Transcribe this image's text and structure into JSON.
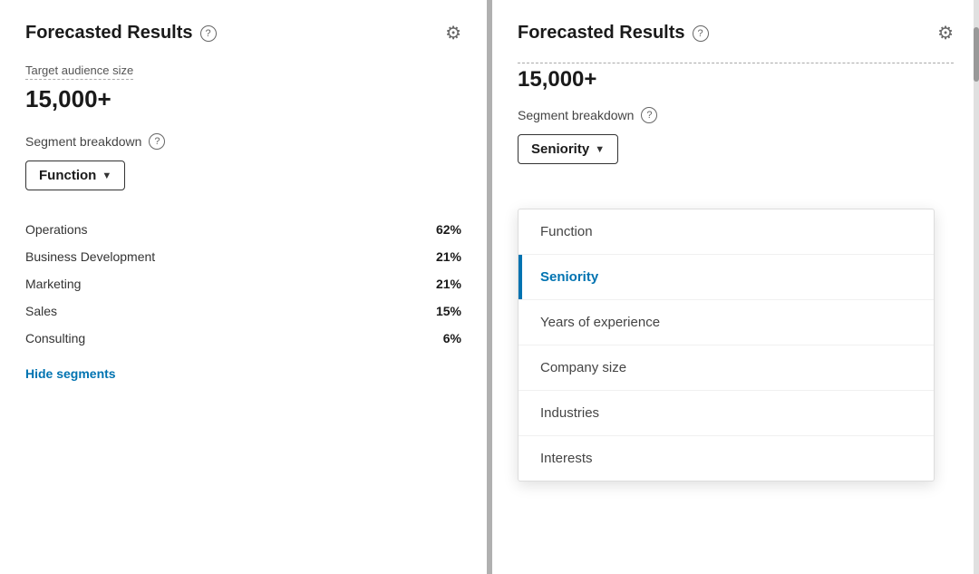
{
  "left_panel": {
    "title": "Forecasted Results",
    "help_icon": "?",
    "gear_icon": "⚙",
    "audience_label": "Target audience size",
    "audience_size": "15,000+",
    "segment_breakdown_label": "Segment breakdown",
    "dropdown_label": "Function",
    "segments": [
      {
        "name": "Operations",
        "pct": "62%"
      },
      {
        "name": "Business Development",
        "pct": "21%"
      },
      {
        "name": "Marketing",
        "pct": "21%"
      },
      {
        "name": "Sales",
        "pct": "15%"
      },
      {
        "name": "Consulting",
        "pct": "6%"
      }
    ],
    "hide_link": "Hide segments"
  },
  "right_panel": {
    "title": "Forecasted Results",
    "help_icon": "?",
    "gear_icon": "⚙",
    "audience_size": "15,000+",
    "segment_breakdown_label": "Segment breakdown",
    "dropdown_label": "Seniority",
    "dropdown_menu_items": [
      {
        "label": "Function",
        "active": false
      },
      {
        "label": "Seniority",
        "active": true
      },
      {
        "label": "Years of experience",
        "active": false
      },
      {
        "label": "Company size",
        "active": false
      },
      {
        "label": "Industries",
        "active": false
      },
      {
        "label": "Interests",
        "active": false
      }
    ]
  }
}
